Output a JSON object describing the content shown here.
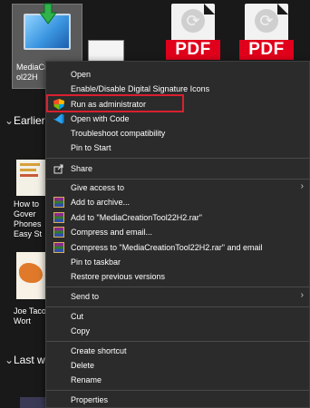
{
  "explorer": {
    "selected_file_label_line1": "MediaCr",
    "selected_file_label_line2": "ol22H",
    "pdf_badge": "PDF",
    "section_earlier": "Earlier",
    "section_last_week": "Last we",
    "side_item_1": "How to\nGover\nPhones\nEasy St",
    "side_item_2": "Joe Taco\nWort"
  },
  "context_menu": {
    "open": "Open",
    "digital_signature": "Enable/Disable Digital Signature Icons",
    "run_as_admin": "Run as administrator",
    "open_with_code": "Open with Code",
    "troubleshoot": "Troubleshoot compatibility",
    "pin_to_start": "Pin to Start",
    "share": "Share",
    "give_access_to": "Give access to",
    "add_to_archive": "Add to archive...",
    "add_to_rar": "Add to \"MediaCreationTool22H2.rar\"",
    "compress_email": "Compress and email...",
    "compress_rar_email": "Compress to \"MediaCreationTool22H2.rar\" and email",
    "pin_to_taskbar": "Pin to taskbar",
    "restore_versions": "Restore previous versions",
    "send_to": "Send to",
    "cut": "Cut",
    "copy": "Copy",
    "create_shortcut": "Create shortcut",
    "delete": "Delete",
    "rename": "Rename",
    "properties": "Properties"
  },
  "colors": {
    "menu_bg": "#2b2b2b",
    "highlight": "#d9202f",
    "pdf_red": "#e0001b"
  },
  "icons": {
    "run_as_admin": "uac-shield-icon",
    "open_with_code": "vscode-icon",
    "share": "share-icon",
    "winrar": "winrar-icon",
    "submenu": "chevron-right-icon"
  }
}
